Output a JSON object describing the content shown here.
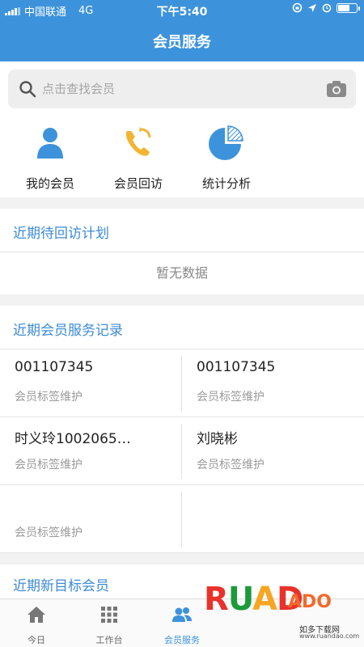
{
  "status_bar": {
    "carrier": "中国联通",
    "network": "4G",
    "time": "下午5:40"
  },
  "header": {
    "title": "会员服务"
  },
  "search": {
    "placeholder": "点击查找会员"
  },
  "shortcuts": [
    {
      "label": "我的会员",
      "icon": "person-icon",
      "color": "#3d93db"
    },
    {
      "label": "会员回访",
      "icon": "phone-callback-icon",
      "color": "#f2b431"
    },
    {
      "label": "统计分析",
      "icon": "pie-chart-icon",
      "color": "#3d93db"
    }
  ],
  "plan_section": {
    "title": "近期待回访计划",
    "empty_text": "暂无数据"
  },
  "records_section": {
    "title": "近期会员服务记录",
    "items": [
      {
        "name": "001107345",
        "sub": "会员标签维护"
      },
      {
        "name": "001107345",
        "sub": "会员标签维护"
      },
      {
        "name": "时义玲1002065…",
        "sub": "会员标签维护"
      },
      {
        "name": "刘晓彬",
        "sub": "会员标签维护"
      },
      {
        "name": "",
        "sub": "会员标签维护"
      }
    ]
  },
  "new_targets_section": {
    "title": "近期新目标会员"
  },
  "tabbar": {
    "active": "会员服务",
    "tabs": [
      {
        "label": "今日",
        "icon": "home-icon"
      },
      {
        "label": "工作台",
        "icon": "grid-icon"
      },
      {
        "label": "会员服务",
        "icon": "members-icon"
      }
    ]
  },
  "watermark": {
    "brand": "RUANDADO",
    "tagline": "如多下载网",
    "url": "www.ruandao.com",
    "colors": {
      "r": "#e8322b",
      "u": "#1b9a3a",
      "a": "#f6a623",
      "n": "#e8322b",
      "dado": "#f26a2a"
    }
  },
  "colors": {
    "primary": "#3d93db",
    "section_title": "#3d8bd6"
  }
}
